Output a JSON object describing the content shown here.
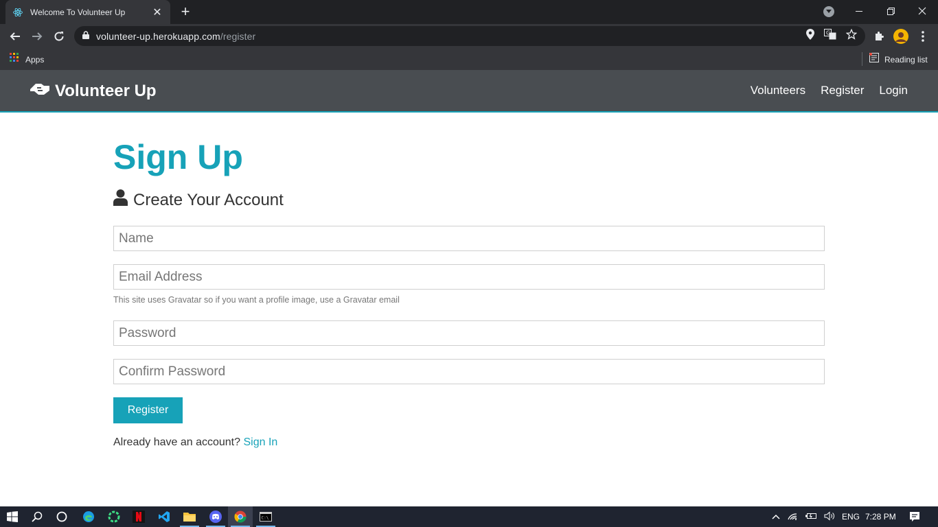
{
  "browser": {
    "tab_title": "Welcome To Volunteer Up",
    "url_host": "volunteer-up.herokuapp.com",
    "url_path": "/register",
    "bookmarks": {
      "apps_label": "Apps",
      "reading_list_label": "Reading list"
    }
  },
  "site": {
    "brand": "Volunteer Up",
    "nav": [
      "Volunteers",
      "Register",
      "Login"
    ],
    "accent_color": "#17a2b8"
  },
  "form": {
    "title": "Sign Up",
    "subtitle": "Create Your Account",
    "name_placeholder": "Name",
    "email_placeholder": "Email Address",
    "email_hint": "This site uses Gravatar so if you want a profile image, use a Gravatar email",
    "password_placeholder": "Password",
    "confirm_placeholder": "Confirm Password",
    "submit_label": "Register",
    "signin_prompt": "Already have an account?",
    "signin_link": "Sign In"
  },
  "taskbar": {
    "language": "ENG",
    "time": "7:28 PM",
    "apps": [
      "start",
      "search",
      "cortana",
      "edge",
      "app-green",
      "netflix",
      "vscode",
      "file-explorer",
      "discord",
      "chrome",
      "terminal"
    ]
  }
}
